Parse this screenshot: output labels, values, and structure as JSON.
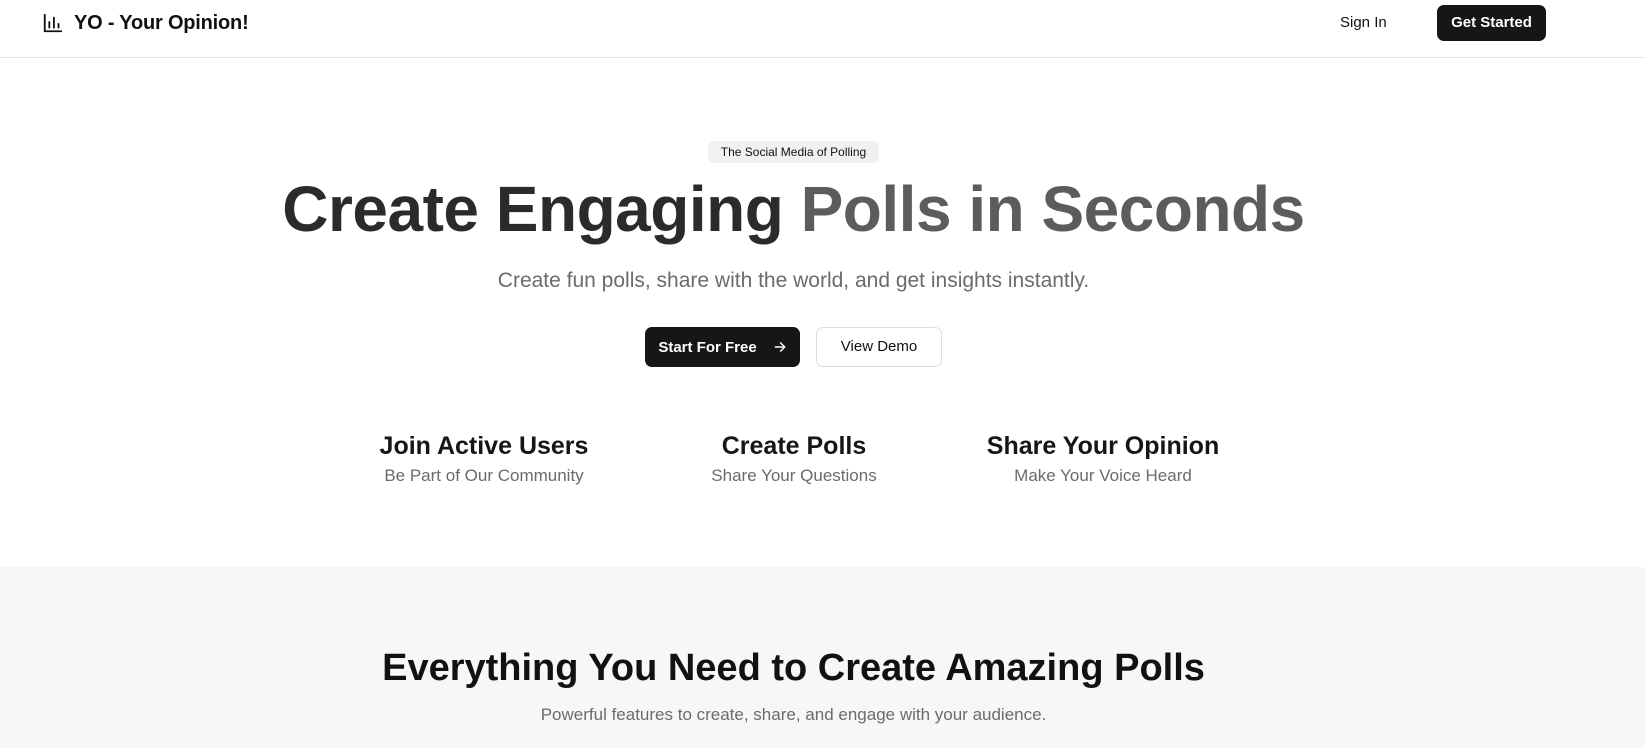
{
  "header": {
    "brand_icon": "bar-chart-icon",
    "brand_name": "YO - Your Opinion!",
    "sign_in_label": "Sign In",
    "get_started_label": "Get Started"
  },
  "hero": {
    "badge": "The Social Media of Polling",
    "title_part1": "Create Engaging ",
    "title_part2": "Polls in Seconds",
    "subtitle": "Create fun polls, share with the world, and get insights instantly.",
    "primary_cta": "Start For Free",
    "primary_cta_icon": "arrow-right-icon",
    "secondary_cta": "View Demo"
  },
  "stats": [
    {
      "title": "Join Active Users",
      "subtitle": "Be Part of Our Community"
    },
    {
      "title": "Create Polls",
      "subtitle": "Share Your Questions"
    },
    {
      "title": "Share Your Opinion",
      "subtitle": "Make Your Voice Heard"
    }
  ],
  "features": {
    "title": "Everything You Need to Create Amazing Polls",
    "subtitle": "Powerful features to create, share, and engage with your audience."
  },
  "colors": {
    "primary_button": "#161616",
    "title_dark": "#2b2b2b",
    "title_light": "#5c5c5c",
    "muted_text": "#6b6b6b",
    "section_background": "#f7f7f7"
  }
}
